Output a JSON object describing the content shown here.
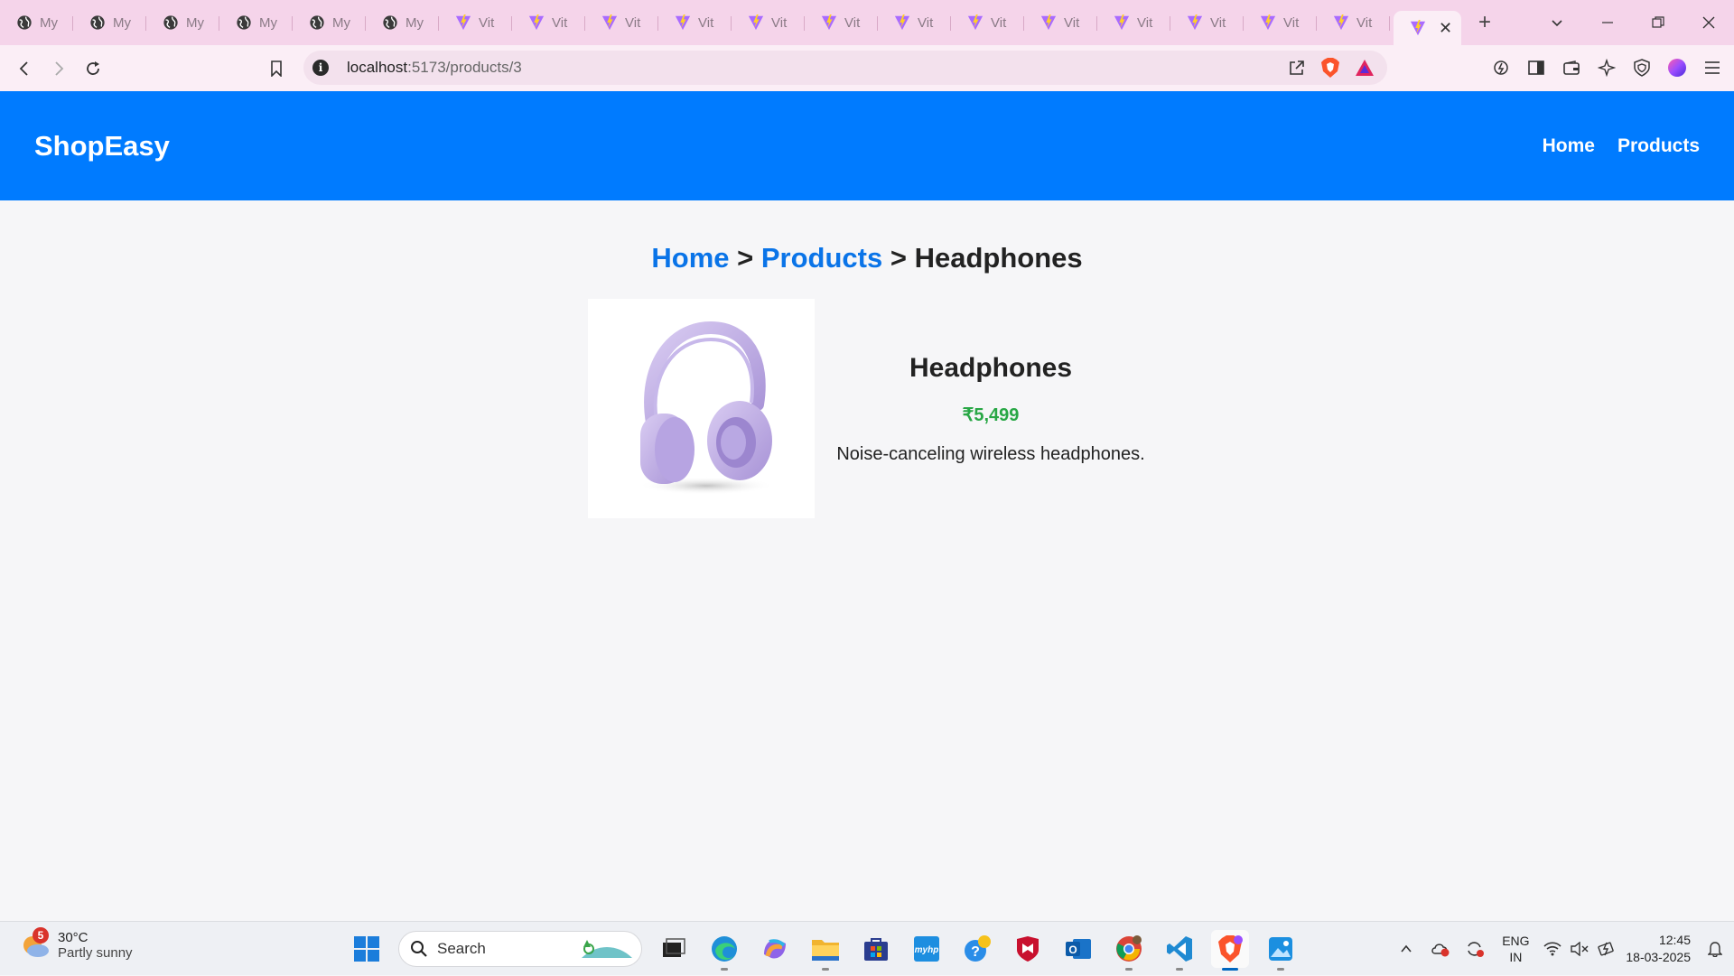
{
  "browser": {
    "tabs": [
      {
        "title": "My",
        "icon": "globe-icon"
      },
      {
        "title": "My",
        "icon": "globe-icon"
      },
      {
        "title": "My",
        "icon": "globe-icon"
      },
      {
        "title": "My",
        "icon": "globe-icon"
      },
      {
        "title": "My",
        "icon": "globe-icon"
      },
      {
        "title": "My",
        "icon": "globe-icon"
      },
      {
        "title": "Vit",
        "icon": "vite-icon"
      },
      {
        "title": "Vit",
        "icon": "vite-icon"
      },
      {
        "title": "Vit",
        "icon": "vite-icon"
      },
      {
        "title": "Vit",
        "icon": "vite-icon"
      },
      {
        "title": "Vit",
        "icon": "vite-icon"
      },
      {
        "title": "Vit",
        "icon": "vite-icon"
      },
      {
        "title": "Vit",
        "icon": "vite-icon"
      },
      {
        "title": "Vit",
        "icon": "vite-icon"
      },
      {
        "title": "Vit",
        "icon": "vite-icon"
      },
      {
        "title": "Vit",
        "icon": "vite-icon"
      },
      {
        "title": "Vit",
        "icon": "vite-icon"
      },
      {
        "title": "Vit",
        "icon": "vite-icon"
      },
      {
        "title": "Vit",
        "icon": "vite-icon"
      }
    ],
    "active_tab_icon": "vite-icon",
    "url_host": "localhost",
    "url_path": ":5173/products/3"
  },
  "app": {
    "brand": "ShopEasy",
    "nav": {
      "home": "Home",
      "products": "Products"
    },
    "breadcrumb": {
      "home": "Home",
      "sep1": " > ",
      "products": "Products",
      "sep2": " > ",
      "current": "Headphones"
    },
    "product": {
      "name": "Headphones",
      "price": "₹5,499",
      "description": "Noise-canceling wireless headphones.",
      "image_alt": "Headphones"
    },
    "colors": {
      "header": "#007bff",
      "price": "#28a745",
      "link": "#0a74e8"
    }
  },
  "taskbar": {
    "weather": {
      "badge": "5",
      "temp": "30°C",
      "condition": "Partly sunny"
    },
    "search_placeholder": "Search",
    "lang": {
      "line1": "ENG",
      "line2": "IN"
    },
    "time": "12:45",
    "date": "18-03-2025"
  }
}
